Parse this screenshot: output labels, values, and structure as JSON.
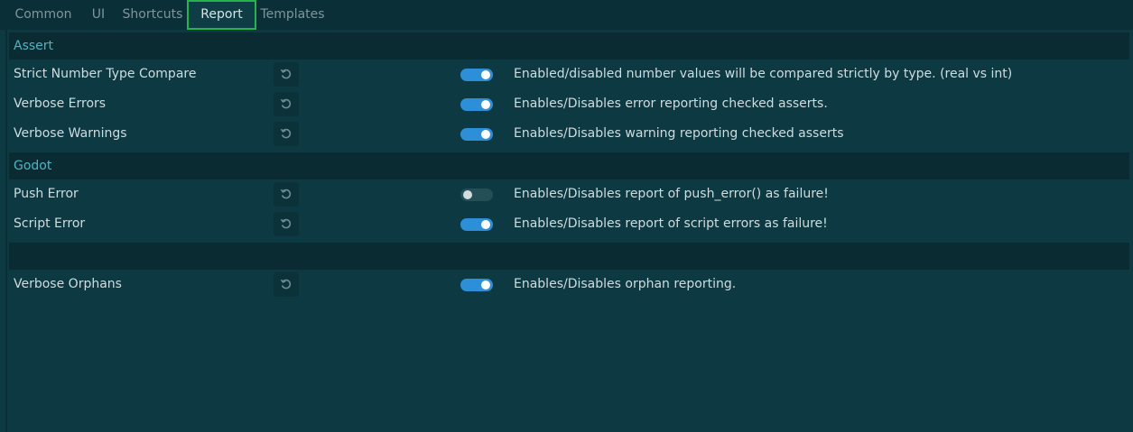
{
  "tabs": [
    {
      "label": "Common"
    },
    {
      "label": "UI"
    },
    {
      "label": "Shortcuts"
    },
    {
      "label": "Report"
    },
    {
      "label": "Templates"
    }
  ],
  "active_tab": "Report",
  "colors": {
    "accent_toggle": "#2d8fd8",
    "active_tab_border": "#26b34a",
    "section_header_text": "#4fb4c2"
  },
  "sections": [
    {
      "title": "Assert"
    },
    {
      "title": "Godot"
    },
    {
      "title": ""
    }
  ],
  "rows": [
    {
      "label": "Strict Number Type Compare",
      "enabled": true,
      "description": "Enabled/disabled number values will be compared strictly by type. (real vs int)",
      "icon": "revert-icon"
    },
    {
      "label": "Verbose Errors",
      "enabled": true,
      "description": "Enables/Disables error reporting checked asserts.",
      "icon": "revert-icon"
    },
    {
      "label": "Verbose Warnings",
      "enabled": true,
      "description": "Enables/Disables warning reporting checked asserts",
      "icon": "revert-icon"
    },
    {
      "label": "Push Error",
      "enabled": false,
      "description": "Enables/Disables report of push_error() as failure!",
      "icon": "revert-icon"
    },
    {
      "label": "Script Error",
      "enabled": true,
      "description": "Enables/Disables report of script errors as failure!",
      "icon": "revert-icon"
    },
    {
      "label": "Verbose Orphans",
      "enabled": true,
      "description": "Enables/Disables orphan reporting.",
      "icon": "revert-icon"
    }
  ]
}
